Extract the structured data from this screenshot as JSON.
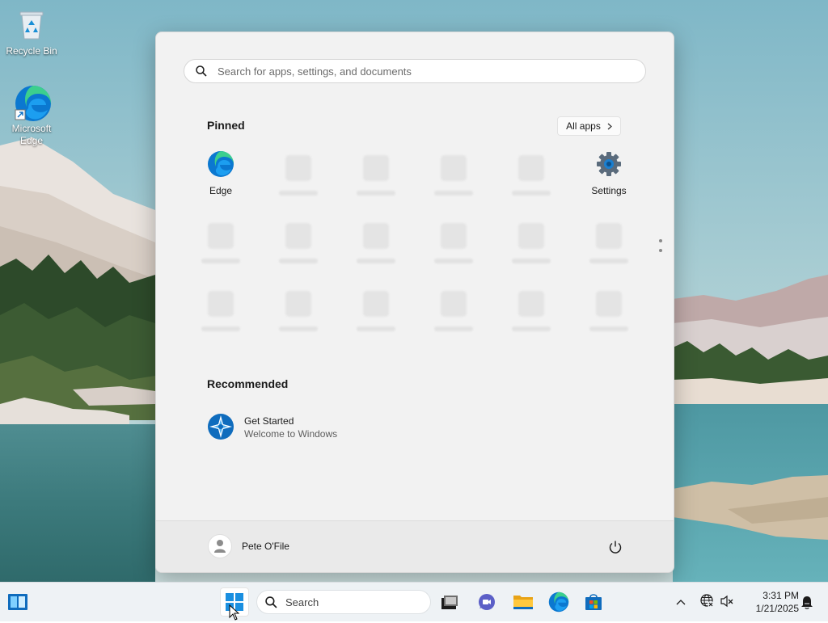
{
  "desktop": {
    "icons": [
      {
        "label": "Recycle Bin",
        "icon": "recycle-bin-icon"
      },
      {
        "label": "Microsoft Edge",
        "icon": "edge-icon"
      }
    ]
  },
  "start_menu": {
    "search": {
      "placeholder": "Search for apps, settings, and documents"
    },
    "pinned": {
      "title": "Pinned",
      "all_apps_label": "All apps",
      "apps": [
        {
          "label": "Edge",
          "icon": "edge-icon"
        },
        {
          "label": "Settings",
          "icon": "settings-gear-icon"
        }
      ]
    },
    "recommended": {
      "title": "Recommended",
      "items": [
        {
          "title": "Get Started",
          "subtitle": "Welcome to Windows",
          "icon": "get-started-icon"
        }
      ]
    },
    "user": {
      "name": "Pete O'File"
    },
    "power_icon": "power-icon"
  },
  "taskbar": {
    "search_placeholder": "Search",
    "apps": [
      "widgets-icon",
      "start-icon",
      "task-view-icon",
      "teams-chat-icon",
      "file-explorer-icon",
      "edge-icon",
      "store-icon"
    ],
    "tray": {
      "time": "3:31 PM",
      "date": "1/21/2025",
      "icons": [
        "chevron-up-icon",
        "network-icon",
        "volume-muted-icon",
        "notification-icon"
      ]
    }
  },
  "colors": {
    "accent": "#0078d4",
    "menu_bg": "#f2f2f2",
    "taskbar_bg": "#eef2f5"
  }
}
